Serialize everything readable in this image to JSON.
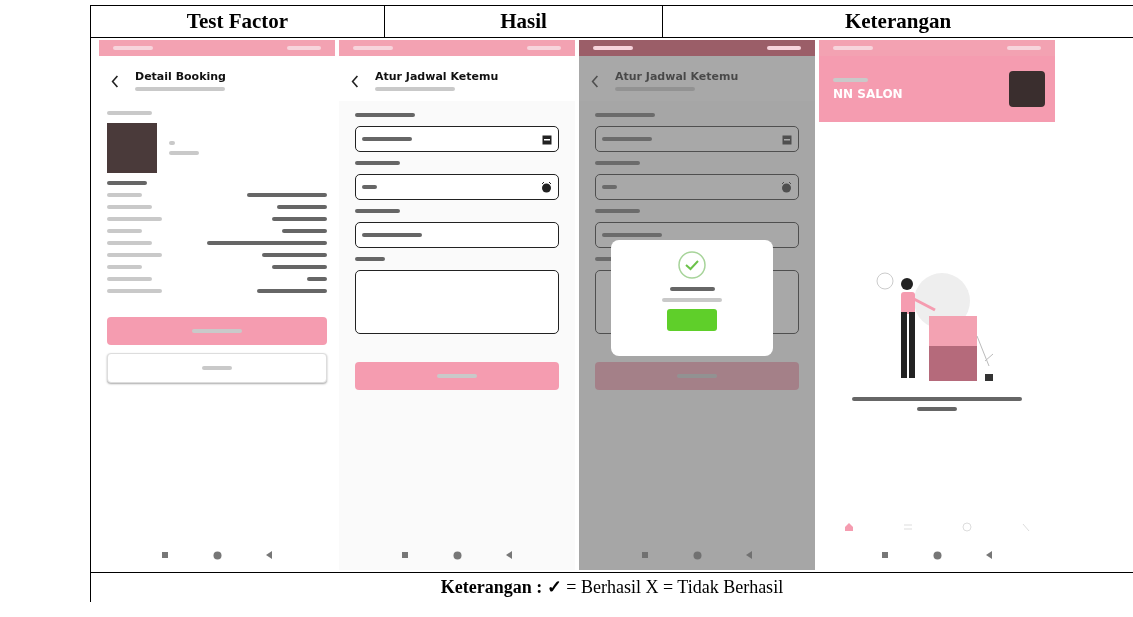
{
  "table": {
    "columns": [
      "Test Factor",
      "Hasil",
      "Keterangan"
    ],
    "screens": [
      {
        "kind": "detail",
        "title": "Detail Booking"
      },
      {
        "kind": "form",
        "title": "Atur Jadwal Ketemu"
      },
      {
        "kind": "form_dialog",
        "title": "Atur Jadwal Ketemu"
      },
      {
        "kind": "home",
        "title": "NN SALON"
      }
    ],
    "legend": "**Keterangan : ✓** = Berhasil X = Tidak Berhasil"
  }
}
